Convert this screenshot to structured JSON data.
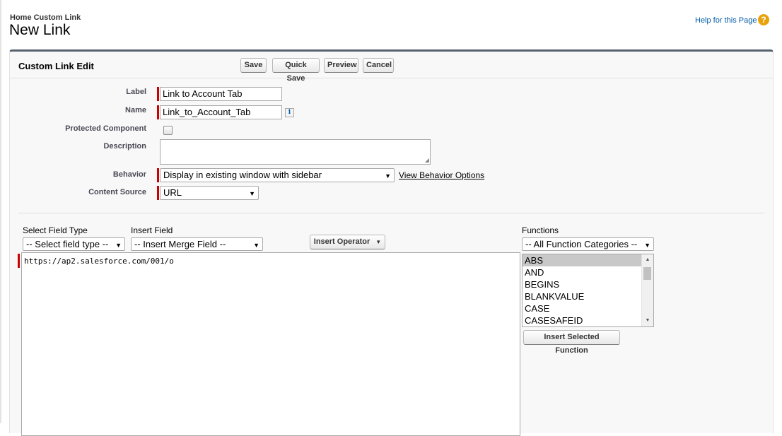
{
  "header": {
    "breadcrumb": "Home Custom Link",
    "title": "New Link",
    "help_link": "Help for this Page",
    "help_icon": "?"
  },
  "panel": {
    "title": "Custom Link Edit",
    "buttons": {
      "save": "Save",
      "quick_save": "Quick Save",
      "preview": "Preview",
      "cancel": "Cancel"
    }
  },
  "form": {
    "label": {
      "label": "Label",
      "value": "Link to Account Tab"
    },
    "name": {
      "label": "Name",
      "value": "Link_to_Account_Tab",
      "info_icon": "i"
    },
    "protected": {
      "label": "Protected Component",
      "checked": false
    },
    "description": {
      "label": "Description",
      "value": ""
    },
    "behavior": {
      "label": "Behavior",
      "value": "Display in existing window with sidebar",
      "link": "View Behavior Options"
    },
    "content_source": {
      "label": "Content Source",
      "value": "URL"
    }
  },
  "builder": {
    "select_field_type": {
      "label": "Select Field Type",
      "value": "-- Select field type --"
    },
    "insert_field": {
      "label": "Insert Field",
      "value": "-- Insert Merge Field --"
    },
    "insert_operator": "Insert Operator",
    "formula_text": "https://ap2.salesforce.com/001/o",
    "functions": {
      "label": "Functions",
      "category": "-- All Function Categories --",
      "items": [
        "ABS",
        "AND",
        "BEGINS",
        "BLANKVALUE",
        "CASE",
        "CASESAFEID"
      ],
      "selected": "ABS",
      "insert_button": "Insert Selected Function"
    }
  },
  "colors": {
    "required": "#cc0000",
    "panel_border": "#56636f",
    "link": "#015ba7",
    "help_icon": "#e8a20c"
  }
}
